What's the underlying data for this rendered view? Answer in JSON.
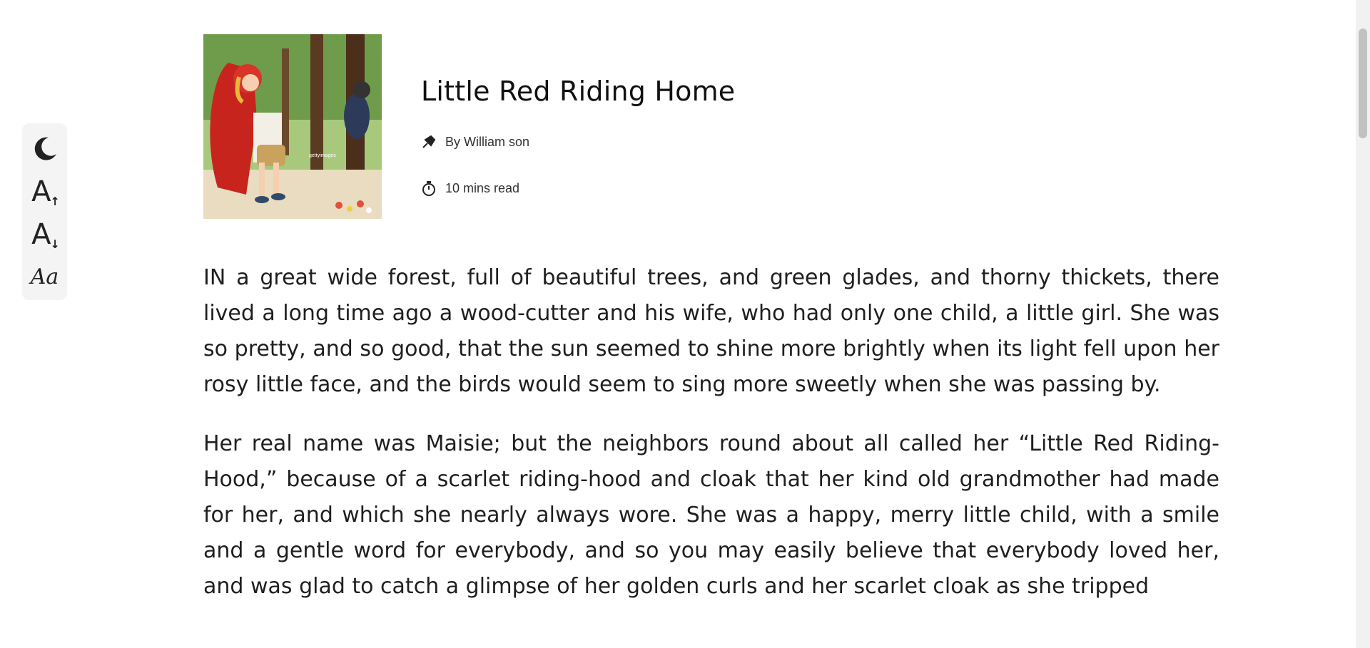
{
  "toolbar": {
    "items": [
      {
        "name": "dark-mode-toggle",
        "icon": "moon-icon"
      },
      {
        "name": "increase-font-size",
        "icon": "font-size-up-icon",
        "glyph": "A"
      },
      {
        "name": "decrease-font-size",
        "icon": "font-size-down-icon",
        "glyph": "A"
      },
      {
        "name": "change-font-family",
        "icon": "font-family-icon",
        "glyph": "Aa"
      }
    ]
  },
  "story": {
    "title": "Little Red Riding Home",
    "author": "By William son",
    "read_time": "10 mins read",
    "cover_icon": "story-cover-image",
    "watermark": "gettyimages",
    "paragraphs": [
      "IN a great wide forest, full of beautiful trees, and green glades, and thorny thickets, there lived a long time ago a wood-cutter and his wife, who had only one child, a little girl. She was so pretty, and so good, that the sun seemed to shine more brightly when its light fell upon her rosy little face, and the birds would seem to sing more sweetly when she was passing by.",
      "Her real name was Maisie; but the neighbors round about all called her “Little Red Riding-Hood,” because of a scarlet riding-hood and cloak that her kind old grandmother had made for her, and which she nearly always wore. She was a happy, merry little child, with a smile and a gentle word for everybody, and so you may easily believe that everybody loved her, and was glad to catch a glimpse of her golden curls and her scarlet cloak as she tripped"
    ]
  },
  "colors": {
    "background": "#ffffff",
    "toolbar_bg": "#f4f4f4",
    "text": "#1f1f1f",
    "scrollbar_thumb": "#c1c1c1"
  }
}
